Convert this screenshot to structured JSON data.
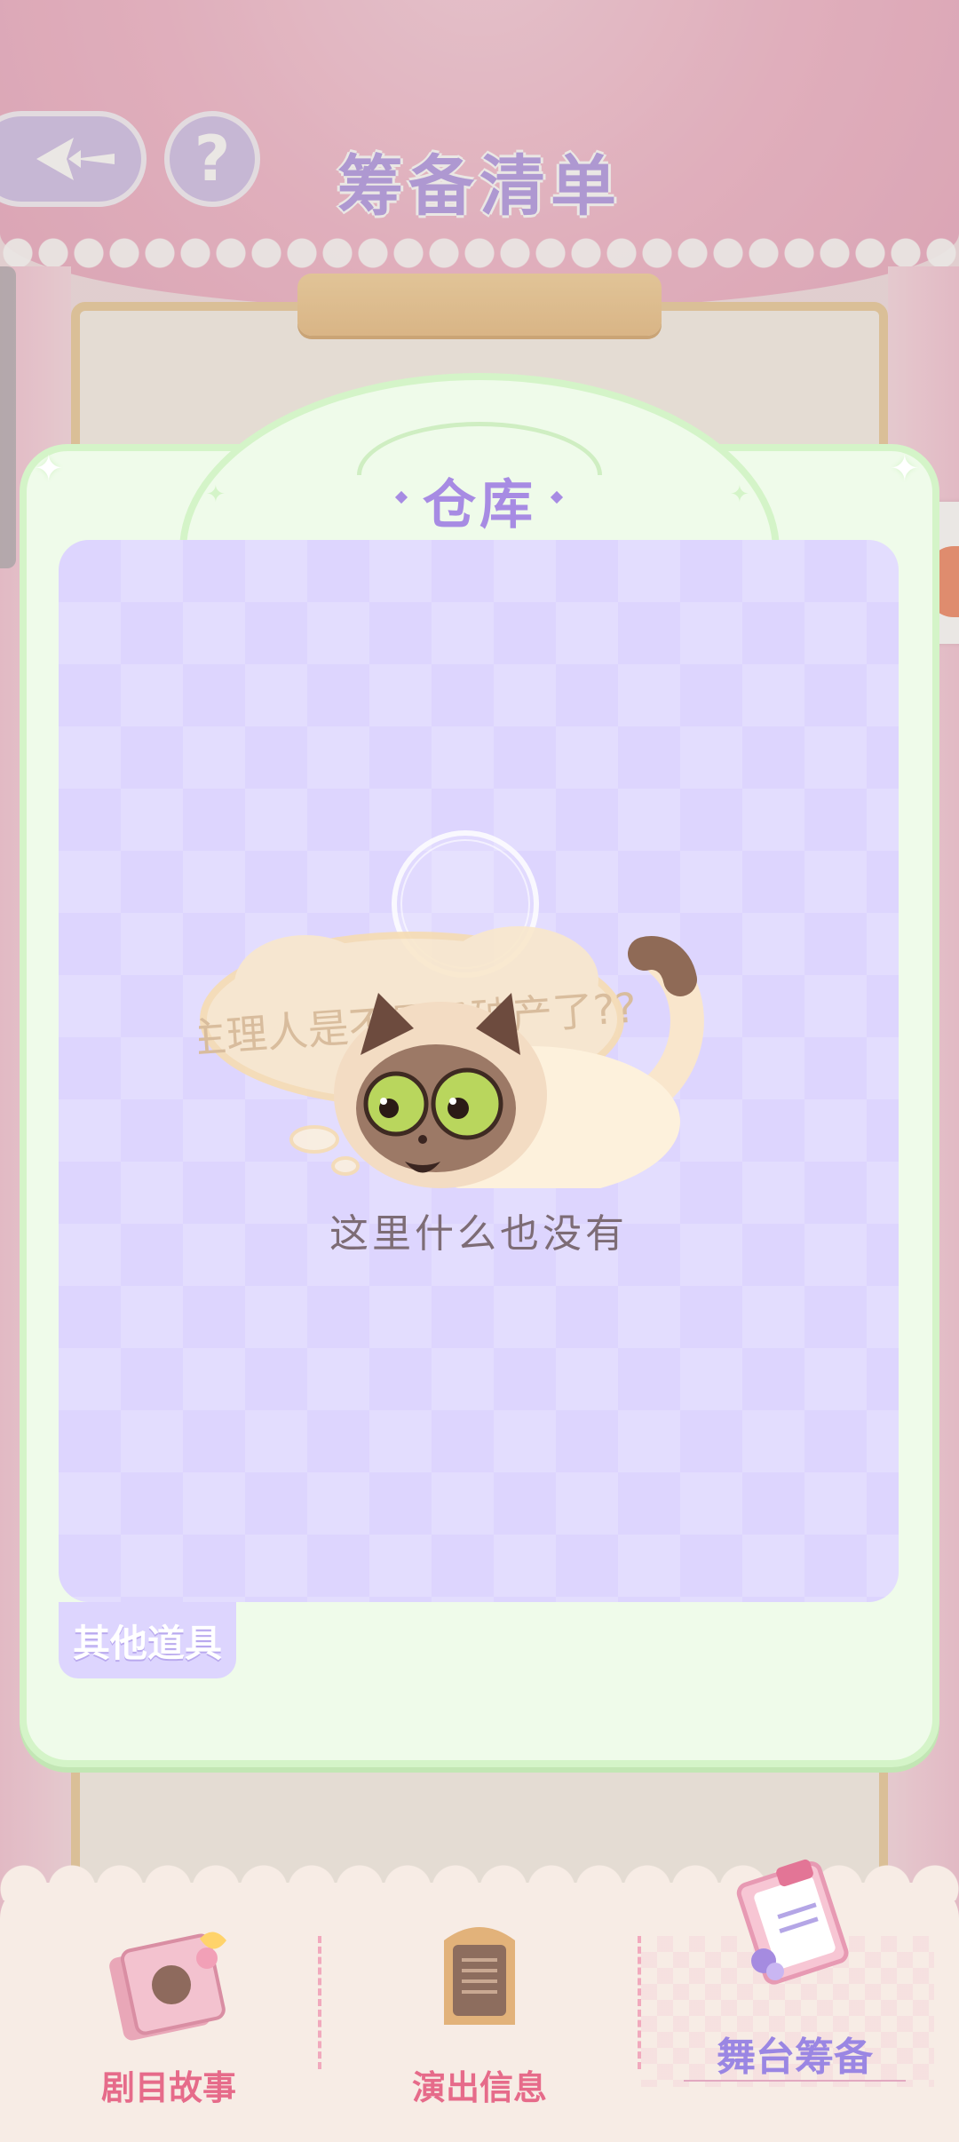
{
  "header": {
    "title": "筹备清单",
    "help_symbol": "?"
  },
  "panel": {
    "title": "仓库",
    "empty_message": "这里什么也没有",
    "thought_bubble_text": "主理人是不是又破产了??",
    "active_tab": "其他道具"
  },
  "bottom_nav": {
    "items": [
      {
        "label": "剧目故事"
      },
      {
        "label": "演出信息"
      },
      {
        "label": "舞台筹备"
      }
    ],
    "active_index": 2
  },
  "colors": {
    "title_purple": "#a78be3",
    "panel_green": "#effbea",
    "content_lavender": "#ddd5fe",
    "nav_pink": "#e66b8a"
  }
}
